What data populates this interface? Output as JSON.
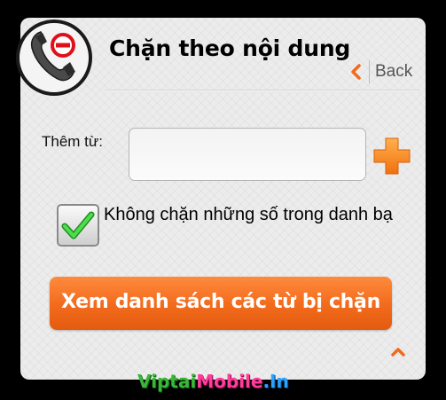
{
  "header": {
    "title": "Chặn theo nội dung",
    "back_label": "Back"
  },
  "form": {
    "add_label": "Thêm từ:",
    "add_input_value": "",
    "checkbox_label": "Không chặn những số trong danh bạ",
    "checkbox_checked": true,
    "view_button_label": "Xem danh sách các từ bị chặn"
  },
  "watermark": {
    "part1": "Viptai",
    "part2": "Mobile",
    "part3": ".In"
  },
  "icons": {
    "logo": "phone-block-icon",
    "back": "chevron-left-icon",
    "add": "plus-icon",
    "check": "checkmark-icon",
    "scroll_up": "chevron-up-icon"
  },
  "colors": {
    "accent": "#f26a1b",
    "check_green": "#2fbf2f",
    "block_red": "#e0101a"
  }
}
